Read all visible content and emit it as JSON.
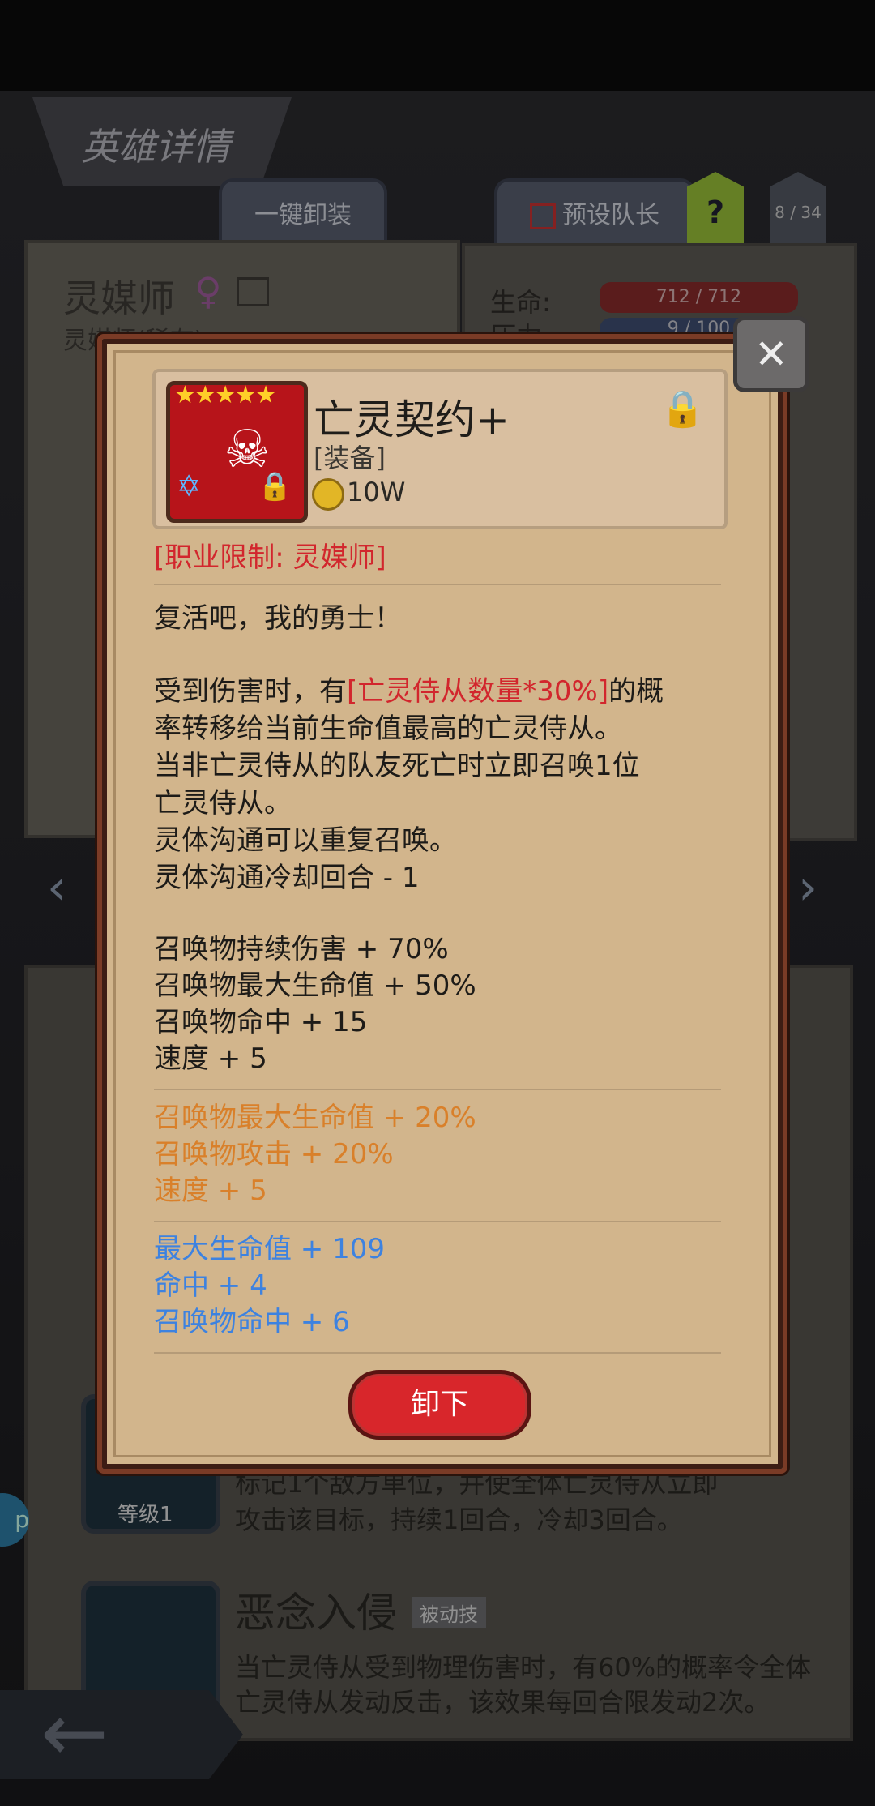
{
  "screen": {
    "title": "英雄详情",
    "tab_unequip_all": "一键卸装",
    "tab_preset_leader": "预设队长",
    "help": "?",
    "page_count": "8 / 34"
  },
  "hero": {
    "name": "灵媒师",
    "subtitle": "灵媒师(稀有)"
  },
  "stats": {
    "hp_label": "生命:",
    "hp_value": "712 / 712",
    "pressure_label": "压力:",
    "pressure_value": "9 / 100"
  },
  "skills": {
    "level_label": "等级1",
    "skill_desc_line1": "标记1个敌方单位，并使全体亡灵侍从立即",
    "skill_desc_line2": "攻击该目标，持续1回合，冷却3回合。",
    "passive_title": "恶念入侵",
    "passive_badge": "被动技",
    "passive_desc_line1": "当亡灵侍从受到物理伤害时，有60%的概率令全体",
    "passive_desc_line2": "亡灵侍从发动反击，该效果每回合限发动2次。"
  },
  "item": {
    "name": "亡灵契约+",
    "type": "[装备]",
    "price": "10W",
    "stars": "★★★★★",
    "class_restriction": "[职业限制: 灵媒师]",
    "flavor": "复活吧，我的勇士！",
    "effect_prefix": "受到伤害时，有",
    "effect_highlight": "[亡灵侍从数量*30%]",
    "effect_suffix": "的概",
    "effect_line2": "率转移给当前生命值最高的亡灵侍从。",
    "effect_line3": "当非亡灵侍从的队友死亡时立即召唤1位",
    "effect_line4": "亡灵侍从。",
    "effect_line5": "灵体沟通可以重复召唤。",
    "effect_line6": "灵体沟通冷却回合 - 1",
    "base_stats": [
      "召唤物持续伤害 + 70%",
      "召唤物最大生命值 + 50%",
      "召唤物命中 + 15",
      "速度 + 5"
    ],
    "bonus_stats": [
      "召唤物最大生命值 + 20%",
      "召唤物攻击 + 20%",
      "速度 + 5"
    ],
    "extra_stats": [
      "最大生命值 + 109",
      "命中 + 4",
      "召唤物命中 + 6"
    ],
    "unequip_label": "卸下"
  },
  "colors": {
    "restriction": "#d2262d",
    "bonus": "#d9802a",
    "extra": "#3d82e0",
    "button": "#d8262b"
  }
}
